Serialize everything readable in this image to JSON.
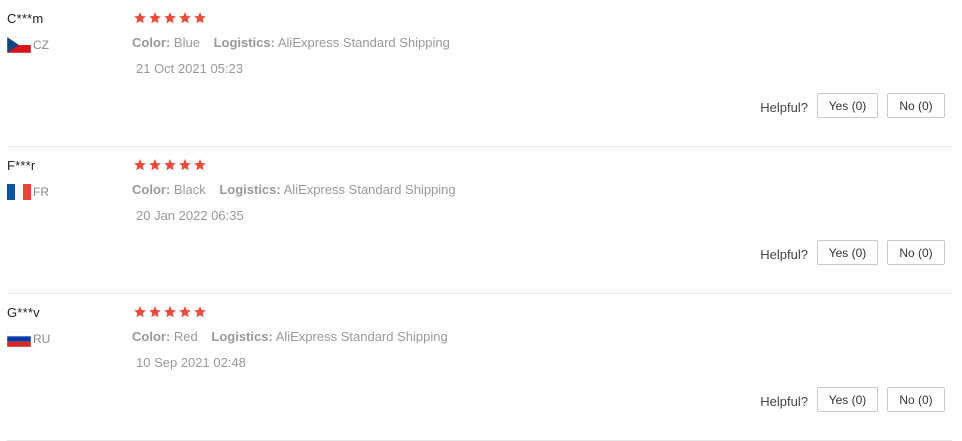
{
  "colors": {
    "star": "#e74c3c",
    "muted_text": "#999999",
    "divider": "#e8e8e8",
    "button_border": "#c9c9c9"
  },
  "rating_icon": "star-icon",
  "helpful_label": "Helpful?",
  "reviews": [
    {
      "user": "C***m",
      "country_code": "CZ",
      "flag_icon": "czech-flag-icon",
      "stars": 5,
      "color_label": "Color:",
      "color_value": "Blue",
      "logistics_label": "Logistics:",
      "logistics_value": "AliExpress Standard Shipping",
      "date": "21 Oct 2021 05:23",
      "yes_label": "Yes (0)",
      "no_label": "No (0)"
    },
    {
      "user": "F***r",
      "country_code": "FR",
      "flag_icon": "france-flag-icon",
      "stars": 5,
      "color_label": "Color:",
      "color_value": "Black",
      "logistics_label": "Logistics:",
      "logistics_value": "AliExpress Standard Shipping",
      "date": "20 Jan 2022 06:35",
      "yes_label": "Yes (0)",
      "no_label": "No (0)"
    },
    {
      "user": "G***v",
      "country_code": "RU",
      "flag_icon": "russia-flag-icon",
      "stars": 5,
      "color_label": "Color:",
      "color_value": "Red",
      "logistics_label": "Logistics:",
      "logistics_value": "AliExpress Standard Shipping",
      "date": "10 Sep 2021 02:48",
      "yes_label": "Yes (0)",
      "no_label": "No (0)"
    }
  ]
}
